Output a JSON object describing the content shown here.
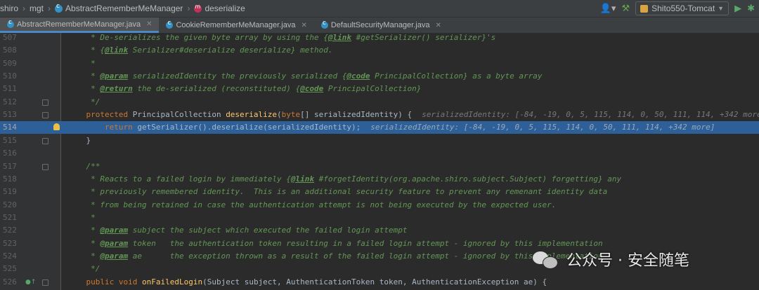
{
  "breadcrumb": {
    "items": [
      "shiro",
      "mgt",
      "AbstractRememberMeManager",
      "deserialize"
    ]
  },
  "toolbar": {
    "run_config": "Shito550-Tomcat"
  },
  "tabs": [
    {
      "label": "AbstractRememberMeManager.java",
      "active": true
    },
    {
      "label": "CookieRememberMeManager.java",
      "active": false
    },
    {
      "label": "DefaultSecurityManager.java",
      "active": false
    }
  ],
  "editor": {
    "lines": [
      {
        "num": "507",
        "text": "     * De-serializes the given byte array by using the {@link #getSerializer() serializer}'s",
        "kind": "doc"
      },
      {
        "num": "508",
        "text": "     * {@link Serializer#deserialize deserialize} method.",
        "kind": "doc"
      },
      {
        "num": "509",
        "text": "     *",
        "kind": "doc"
      },
      {
        "num": "510",
        "text": "     * @param serializedIdentity the previously serialized {@code PrincipalCollection} as a byte array",
        "kind": "doc"
      },
      {
        "num": "511",
        "text": "     * @return the de-serialized (reconstituted) {@code PrincipalCollection}",
        "kind": "doc"
      },
      {
        "num": "512",
        "text": "     */",
        "kind": "doc"
      },
      {
        "num": "513",
        "text": "    protected PrincipalCollection deserialize(byte[] serializedIdentity) {",
        "kind": "sig",
        "hint": "serializedIdentity: [-84, -19, 0, 5, 115, 114, 0, 50, 111, 114, +342 more]"
      },
      {
        "num": "514",
        "text": "        return getSerializer().deserialize(serializedIdentity);",
        "kind": "ret",
        "hint": "serializedIdentity: [-84, -19, 0, 5, 115, 114, 0, 50, 111, 114, +342 more]"
      },
      {
        "num": "515",
        "text": "    }",
        "kind": "code"
      },
      {
        "num": "516",
        "text": "",
        "kind": "code"
      },
      {
        "num": "517",
        "text": "    /**",
        "kind": "doc"
      },
      {
        "num": "518",
        "text": "     * Reacts to a failed login by immediately {@link #forgetIdentity(org.apache.shiro.subject.Subject) forgetting} any",
        "kind": "doc"
      },
      {
        "num": "519",
        "text": "     * previously remembered identity.  This is an additional security feature to prevent any remenant identity data",
        "kind": "doc"
      },
      {
        "num": "520",
        "text": "     * from being retained in case the authentication attempt is not being executed by the expected user.",
        "kind": "doc"
      },
      {
        "num": "521",
        "text": "     *",
        "kind": "doc"
      },
      {
        "num": "522",
        "text": "     * @param subject the subject which executed the failed login attempt",
        "kind": "doc"
      },
      {
        "num": "523",
        "text": "     * @param token   the authentication token resulting in a failed login attempt - ignored by this implementation",
        "kind": "doc"
      },
      {
        "num": "524",
        "text": "     * @param ae      the exception thrown as a result of the failed login attempt - ignored by this implementation",
        "kind": "doc"
      },
      {
        "num": "525",
        "text": "     */",
        "kind": "doc"
      },
      {
        "num": "526",
        "text": "    public void onFailedLogin(Subject subject, AuthenticationToken token, AuthenticationException ae) {",
        "kind": "pub"
      }
    ],
    "current_line": "514"
  },
  "watermark": {
    "text": "公众号 · 安全随笔"
  }
}
